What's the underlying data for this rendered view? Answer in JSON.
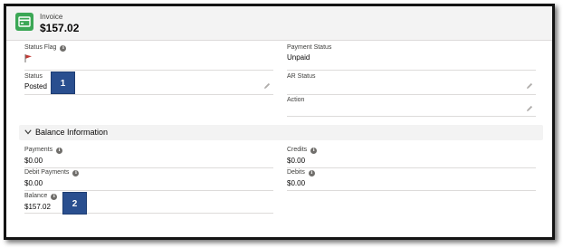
{
  "header": {
    "object_type": "Invoice",
    "amount": "$157.02",
    "icon": "invoice-icon",
    "icon_color": "#3ba755"
  },
  "details": {
    "status_flag": {
      "label": "Status Flag",
      "icon": "red-flag-icon",
      "flag_color": "#c23934"
    },
    "payment_status": {
      "label": "Payment Status",
      "value": "Unpaid"
    },
    "status": {
      "label": "Status",
      "value": "Posted"
    },
    "ar_status": {
      "label": "AR Status",
      "value": ""
    },
    "action": {
      "label": "Action",
      "value": ""
    }
  },
  "balance_section": {
    "title": "Balance Information",
    "payments": {
      "label": "Payments",
      "value": "$0.00"
    },
    "credits": {
      "label": "Credits",
      "value": "$0.00"
    },
    "debit_payments": {
      "label": "Debit Payments",
      "value": "$0.00"
    },
    "debits": {
      "label": "Debits",
      "value": "$0.00"
    },
    "balance": {
      "label": "Balance",
      "value": "$157.02"
    }
  },
  "callouts": {
    "one": "1",
    "two": "2",
    "color": "#2a4f8f"
  }
}
